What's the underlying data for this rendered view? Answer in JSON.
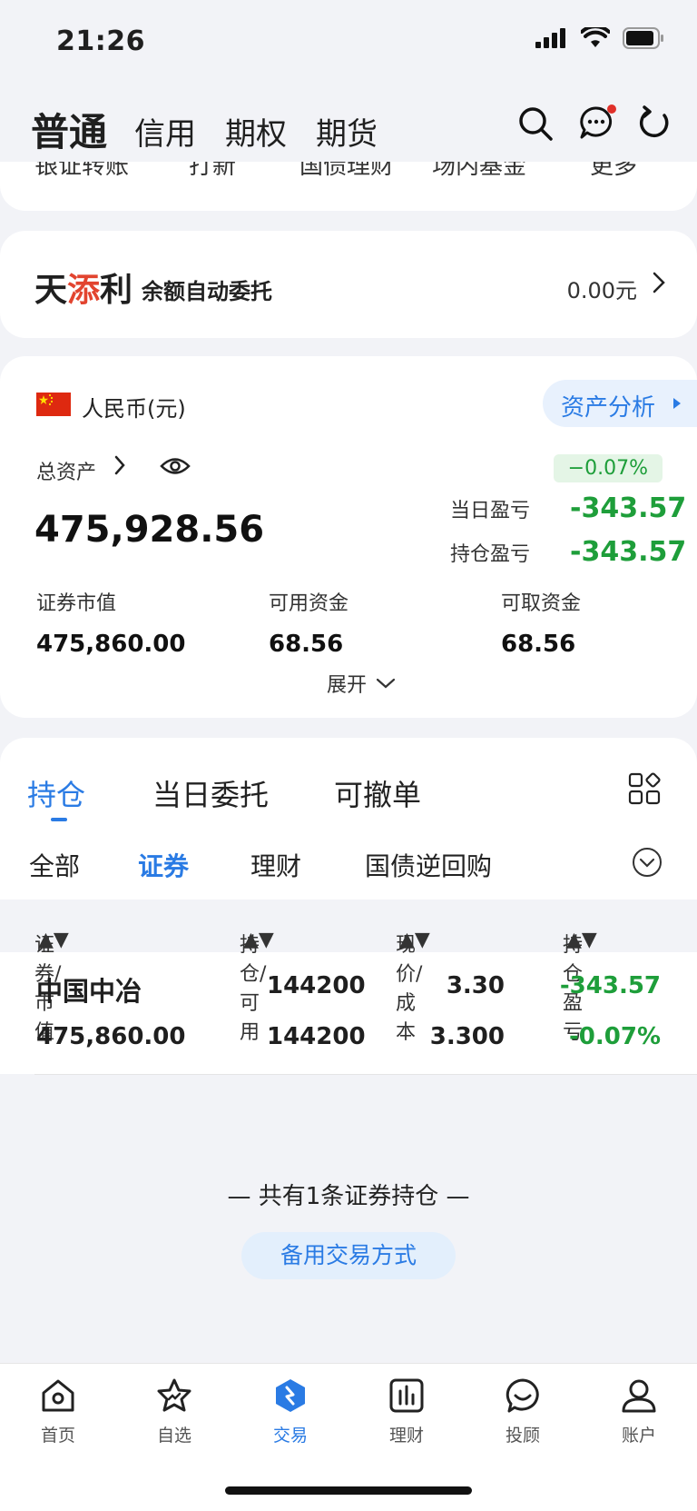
{
  "status_bar": {
    "time": "21:26"
  },
  "top_nav": {
    "tabs": [
      "普通",
      "信用",
      "期权",
      "期货"
    ]
  },
  "shortcuts": [
    "银证转账",
    "打新",
    "国债理财",
    "场内基金",
    "更多"
  ],
  "tiantianli": {
    "logo_black": "天",
    "logo_red": "添",
    "logo_black2": "利",
    "slogan": "余额自动委托",
    "value": "0.00元"
  },
  "assets": {
    "currency": "人民币(元)",
    "analysis_button": "资产分析",
    "total_label": "总资产",
    "total_value": "475,928.56",
    "day_pct": "−0.07%",
    "day_pl_label": "当日盈亏",
    "day_pl_value": "-343.57",
    "hold_pl_label": "持仓盈亏",
    "hold_pl_value": "-343.57",
    "market_value_label": "证券市值",
    "market_value": "475,860.00",
    "available_label": "可用资金",
    "available": "68.56",
    "withdrawable_label": "可取资金",
    "withdrawable": "68.56",
    "expand_label": "展开"
  },
  "holdings": {
    "tabs": [
      "持仓",
      "当日委托",
      "可撤单"
    ],
    "filters": [
      "全部",
      "证券",
      "理财",
      "国债逆回购"
    ],
    "columns": [
      "证券/市值",
      "持仓/可用",
      "现价/成本",
      "持仓盈亏"
    ],
    "rows": [
      {
        "name": "中国中冶",
        "market_value": "475,860.00",
        "position": "144200",
        "available": "144200",
        "price": "3.30",
        "cost": "3.300",
        "pl": "-343.57",
        "pl_pct": "-0.07%"
      }
    ]
  },
  "footer": {
    "note": "— 共有1条证券持仓 —",
    "backup_button": "备用交易方式"
  },
  "bottom_nav": [
    "首页",
    "自选",
    "交易",
    "理财",
    "投顾",
    "账户"
  ],
  "colors": {
    "accent": "#2a7be4",
    "loss": "#1e9e3a",
    "brand_red": "#e2442f"
  }
}
